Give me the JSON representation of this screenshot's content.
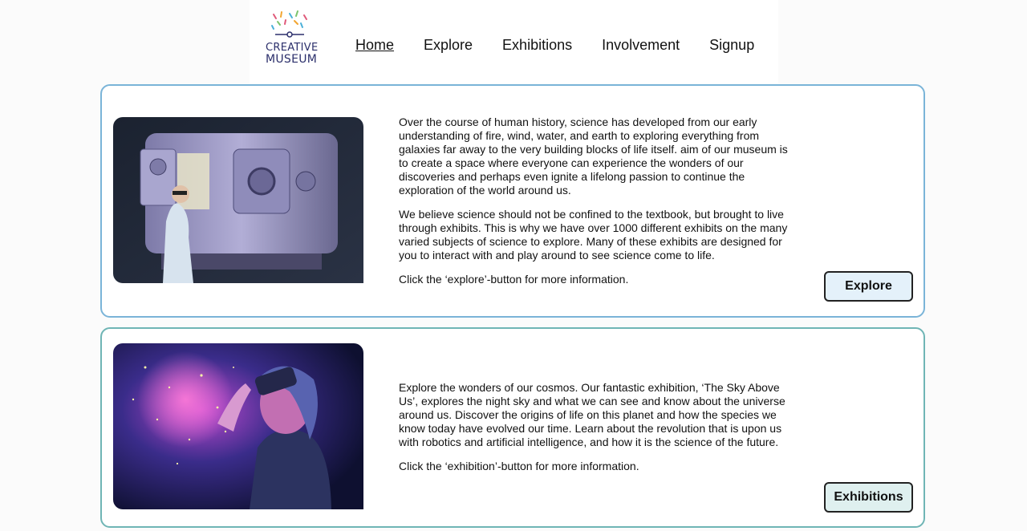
{
  "logo": {
    "line1": "CREATIVE",
    "line2": "MUSEUM"
  },
  "nav": {
    "items": [
      {
        "label": "Home",
        "active": true
      },
      {
        "label": "Explore",
        "active": false
      },
      {
        "label": "Exhibitions",
        "active": false
      },
      {
        "label": "Involvement",
        "active": false
      },
      {
        "label": "Signup",
        "active": false
      }
    ]
  },
  "sections": [
    {
      "paragraphs": [
        "Over the course of human history, science has developed from our early understanding of fire, wind, water, and earth to exploring everything from galaxies far away to the very building blocks of life itself. aim of our museum is to create a space where everyone can experience the wonders of our discoveries and perhaps even ignite a lifelong passion to continue the exploration of the world around us.",
        "We believe science should not be confined to the textbook, but brought to live through exhibits. This is why we have over 1000 different exhibits on the many varied subjects of science to explore. Many of these exhibits are designed for you to interact with and play around to see science come to life.",
        "Click the ‘explore’-button for more information."
      ],
      "button_label": "Explore"
    },
    {
      "paragraphs": [
        "Explore the wonders of our cosmos. Our fantastic exhibition, ‘The Sky Above Us’, explores the night sky and what we can see and know about the universe around us. Discover the origins of life on this planet and how the species we know today have evolved our time. Learn about the revolution that is upon us with robotics and artificial intelligence, and how it is the science of the future.",
        "Click the ‘exhibition’-button for more information."
      ],
      "button_label": "Exhibitions"
    }
  ],
  "colors": {
    "card1_border": "#7ab4d8",
    "card2_border": "#6fb5b5",
    "hex_pink": "#d9708f",
    "hex_blue": "#5d9be0",
    "hex_teal": "#5ec8c0"
  }
}
